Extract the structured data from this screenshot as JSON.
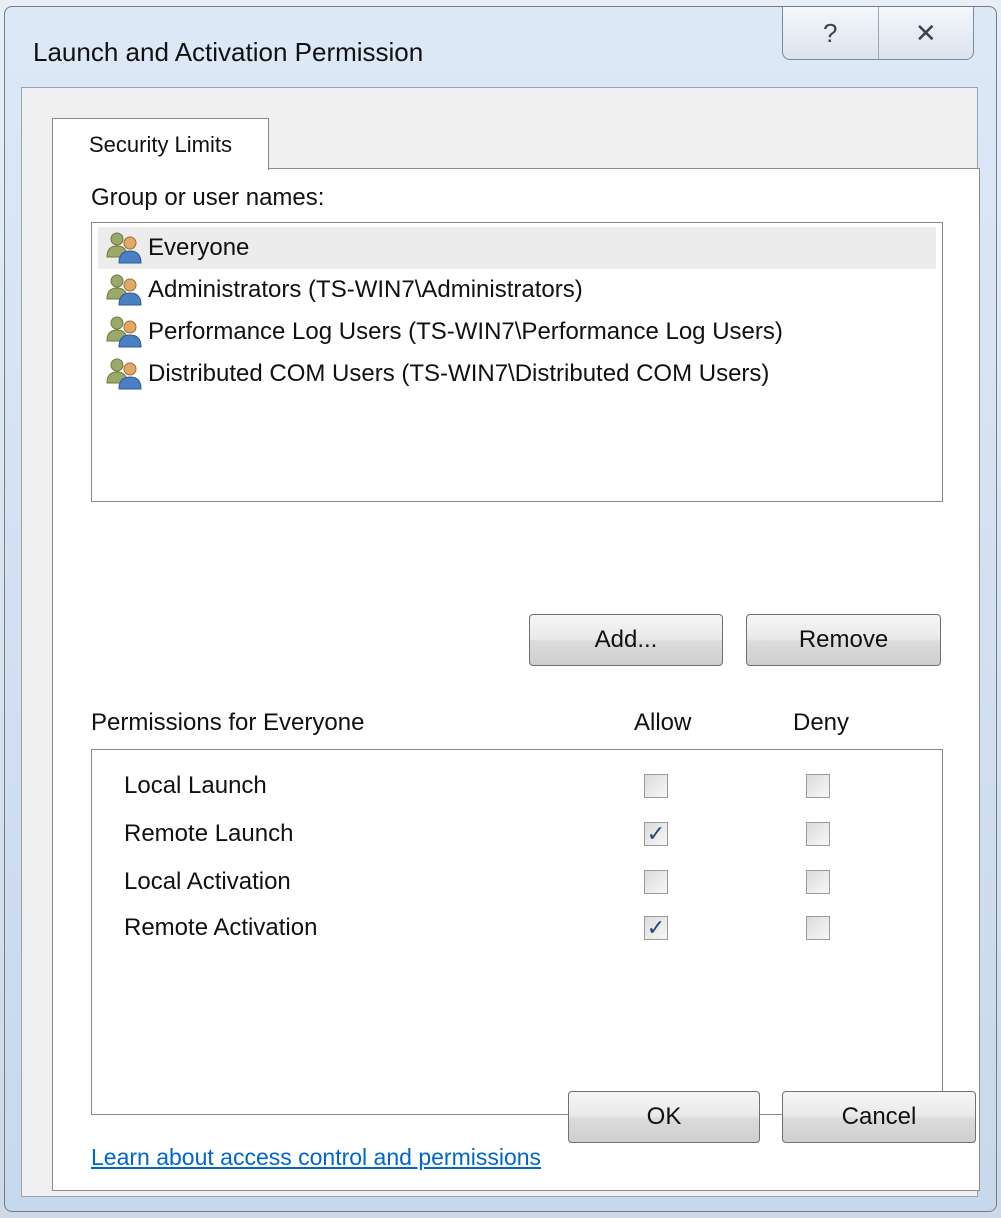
{
  "window": {
    "title": "Launch and Activation Permission",
    "help_glyph": "?",
    "close_glyph": "✕"
  },
  "tab": {
    "label": "Security Limits"
  },
  "groups": {
    "label": "Group or user names:",
    "items": [
      {
        "name": "Everyone",
        "selected": true
      },
      {
        "name": "Administrators (TS-WIN7\\Administrators)",
        "selected": false
      },
      {
        "name": "Performance Log Users (TS-WIN7\\Performance Log Users)",
        "selected": false
      },
      {
        "name": "Distributed COM Users (TS-WIN7\\Distributed COM Users)",
        "selected": false
      }
    ]
  },
  "buttons": {
    "add": "Add...",
    "remove": "Remove",
    "ok": "OK",
    "cancel": "Cancel"
  },
  "permissions": {
    "header": "Permissions for Everyone",
    "allow_header": "Allow",
    "deny_header": "Deny",
    "rows": [
      {
        "name": "Local Launch",
        "allow": false,
        "deny": false
      },
      {
        "name": "Remote Launch",
        "allow": true,
        "deny": false
      },
      {
        "name": "Local Activation",
        "allow": false,
        "deny": false
      },
      {
        "name": "Remote Activation",
        "allow": true,
        "deny": false
      }
    ]
  },
  "link": {
    "text": "Learn about access control and permissions"
  },
  "colors": {
    "link": "#0066cc",
    "check": "#26457a",
    "selected_row": "#ececec"
  },
  "icons": {
    "group": "users-group-icon",
    "help": "help-icon",
    "close": "close-icon",
    "check": "checkmark"
  }
}
